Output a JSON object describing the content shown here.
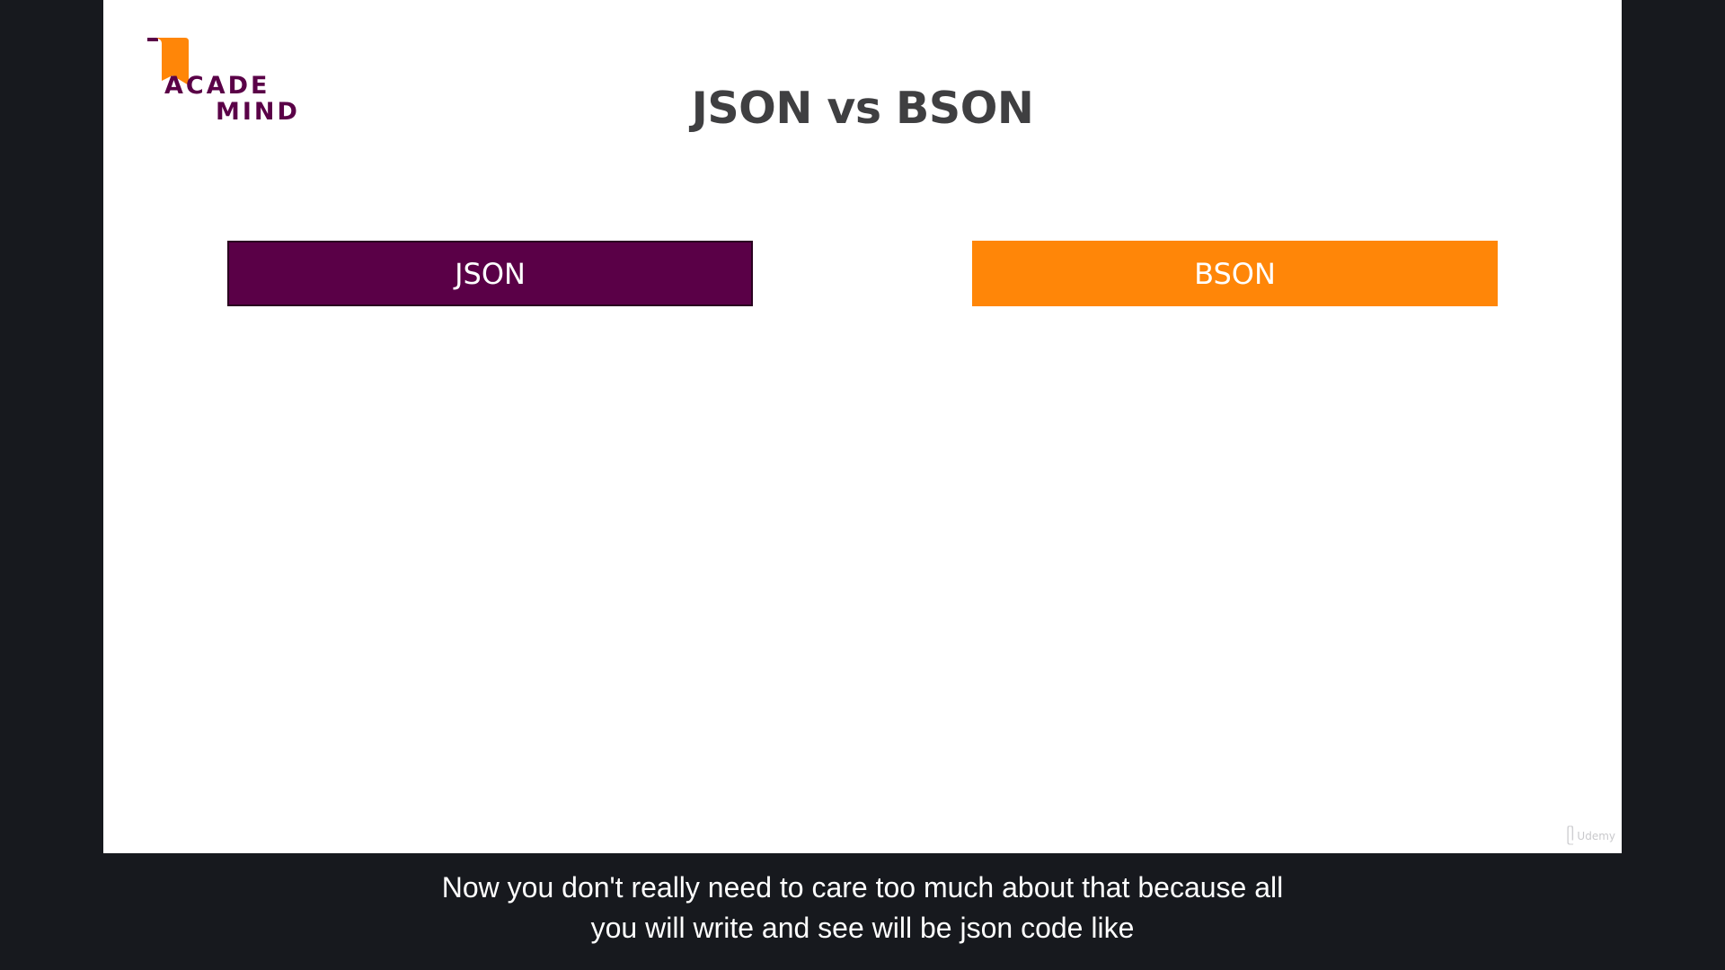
{
  "slide": {
    "logo": {
      "line1": "ACADE",
      "line2": "MIND"
    },
    "title": "JSON vs BSON",
    "columns": [
      {
        "label": "JSON",
        "color": "#5a0047"
      },
      {
        "label": "BSON",
        "color": "#ff8608"
      }
    ],
    "watermark": "Udemy"
  },
  "caption": {
    "line1": "Now you don't really need to care too much about that because all",
    "line2": "you will write and see will be json code like"
  },
  "colors": {
    "background": "#17191e",
    "slide": "#ffffff",
    "brand_purple": "#5a0047",
    "brand_orange": "#ff8608",
    "title_text": "#3f3f41"
  }
}
